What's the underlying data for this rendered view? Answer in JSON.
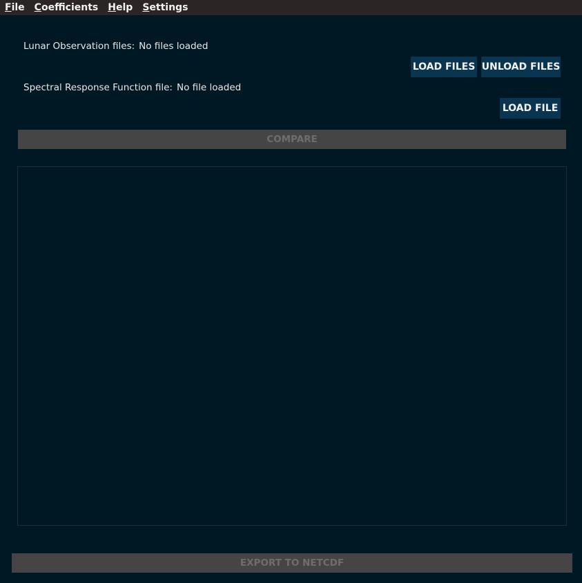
{
  "menu": {
    "file": {
      "mnemonic": "F",
      "rest": "ile"
    },
    "coefficients": {
      "mnemonic": "C",
      "rest": "oefficients"
    },
    "help": {
      "mnemonic": "H",
      "rest": "elp"
    },
    "settings": {
      "mnemonic": "S",
      "rest": "ettings"
    }
  },
  "observations": {
    "label": "Lunar Observation files:",
    "status": "No files loaded",
    "load_button": "LOAD FILES",
    "unload_button": "UNLOAD FILES"
  },
  "srf": {
    "label": "Spectral Response Function file:",
    "status": "No file loaded",
    "load_button": "LOAD FILE"
  },
  "compare_button": "COMPARE",
  "export_button": "EXPORT TO NETCDF",
  "colors": {
    "background": "#001823",
    "menubar": "#2b2525",
    "button": "#0a3550",
    "disabled_button": "#454545",
    "disabled_text": "#6e6e6e"
  }
}
